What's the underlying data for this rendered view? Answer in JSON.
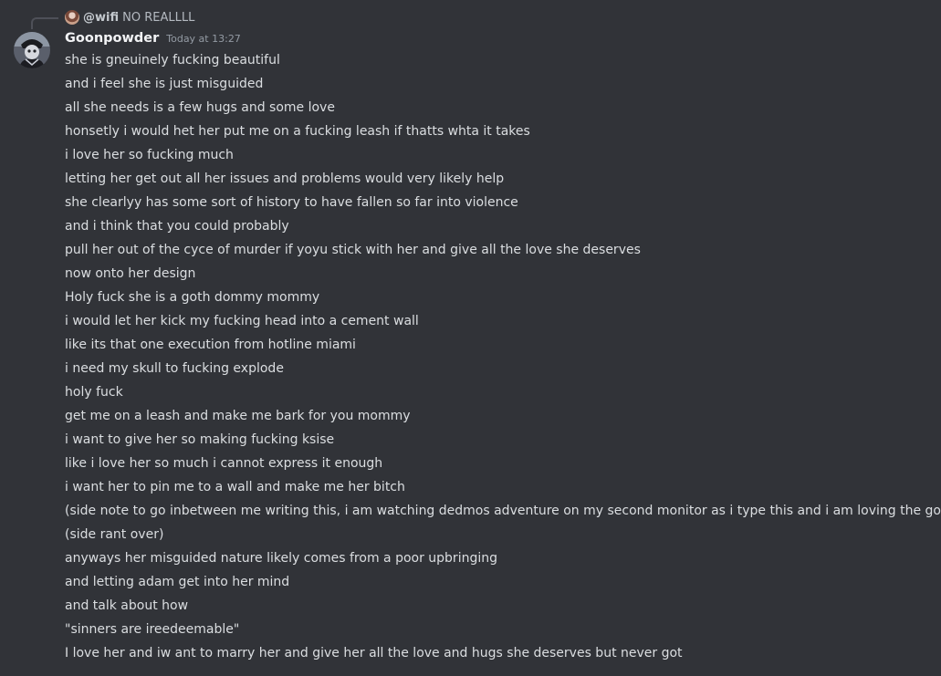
{
  "reply": {
    "author": "@wifi",
    "text": "NO REALLLL"
  },
  "message": {
    "author": "Goonpowder",
    "timestamp": "Today at 13:27",
    "lines": [
      "she is gneuinely fucking beautiful",
      "and i feel she is just misguided",
      "all she needs is a few hugs and some love",
      "honsetly i would het her put me on a fucking leash if thatts whta it takes",
      "i love her so fucking much",
      "letting her get out all her issues and problems would very likely help",
      "she clearlyy has some sort of history to have fallen so far into violence",
      "and i think that you could probably",
      "pull her out of the cyce of murder if yoyu stick with her and give all the love she deserves",
      "now onto her design",
      "Holy fuck she is a goth dommy mommy",
      "i would let her kick my fucking head into a cement wall",
      "like its that one execution from hotline miami",
      "i need my skull to fucking explode",
      "holy fuck",
      "get me on a leash and make me bark for you mommy",
      "i want to give her so making fucking ksise",
      "like i love her so much i cannot express it enough",
      "i want her to pin me to a wall and make me her bitch",
      "(side note to go inbetween me writing this, i am watching dedmos adventure on my second monitor as i type this and i am loving the gore)",
      "(side rant over)",
      "anyways her misguided nature likely comes from a poor upbringing",
      "and letting adam get into her mind",
      "and talk about how",
      "\"sinners are ireedeemable\"",
      "I love her and iw ant to marry her and give her all the love and hugs she deserves but never got"
    ]
  },
  "colors": {
    "background": "#313338",
    "text": "#dbdee1",
    "username": "#f2f3f5",
    "timestamp": "#949ba4",
    "reply_text": "#b5bac1"
  }
}
